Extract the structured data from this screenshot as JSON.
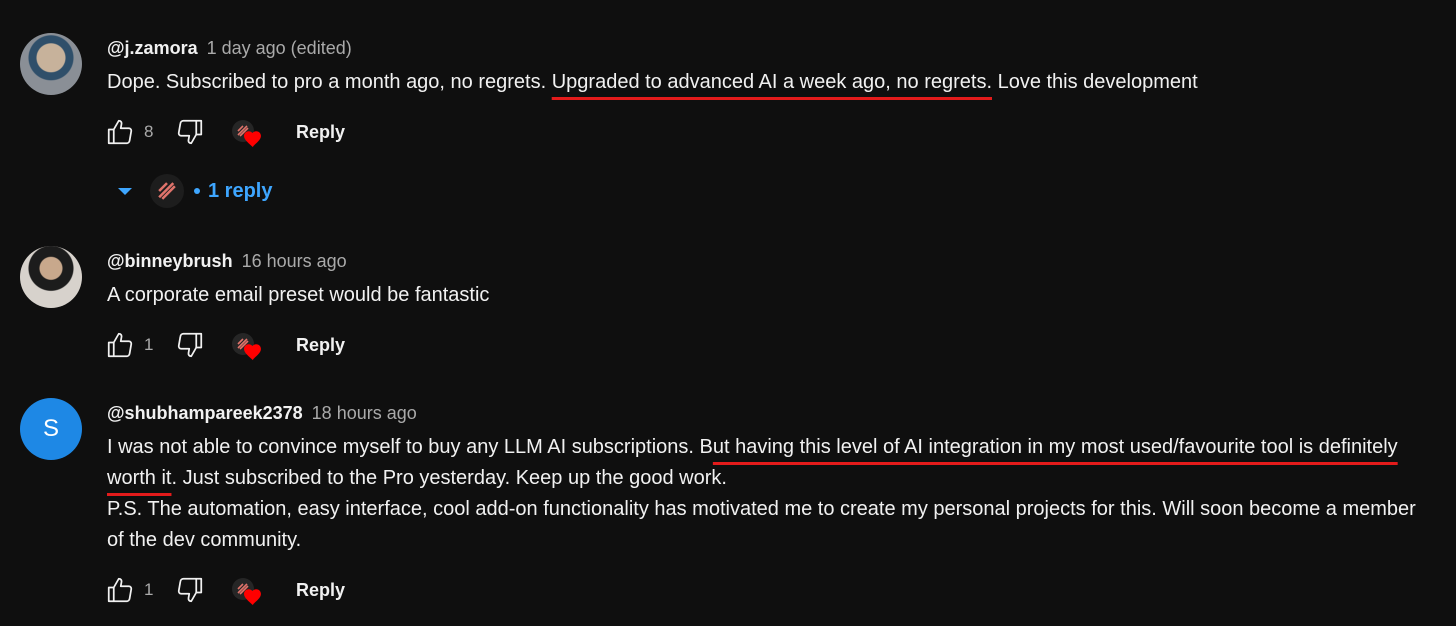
{
  "comments": [
    {
      "author": "@j.zamora",
      "time": "1 day ago (edited)",
      "text_before": "Dope. Subscribed to pro a month ago, no regrets. ",
      "text_highlight": "Upgraded to advanced AI a week ago, no regrets.",
      "text_after": " Love this development",
      "likes": "8",
      "reply_label": "Reply",
      "replies_label": "1 reply"
    },
    {
      "author": "@binneybrush",
      "time": "16 hours ago",
      "text": "A corporate email preset would be fantastic",
      "likes": "1",
      "reply_label": "Reply"
    },
    {
      "author": "@shubhampareek2378",
      "time": "18 hours ago",
      "avatar_letter": "S",
      "text_before": "I was not able to convince myself to buy any LLM AI subscriptions. B",
      "text_highlight": "ut having this level of AI integration in my most used/favourite tool is definitely worth it",
      "text_after": ". Just subscribed to the Pro yesterday. Keep up the good work.",
      "text_ps": "P.S. The automation, easy interface, cool add-on functionality has motivated me to create my personal projects for this. Will soon become a member of the dev community.",
      "likes": "1",
      "reply_label": "Reply"
    }
  ],
  "colors": {
    "background": "#0f0f0f",
    "link_blue": "#3ea6ff",
    "highlight_red": "#e31b1b",
    "heart_red": "#ff0000"
  },
  "icons": [
    "thumb-up-icon",
    "thumb-down-icon",
    "creator-heart-icon",
    "caret-down-icon"
  ]
}
